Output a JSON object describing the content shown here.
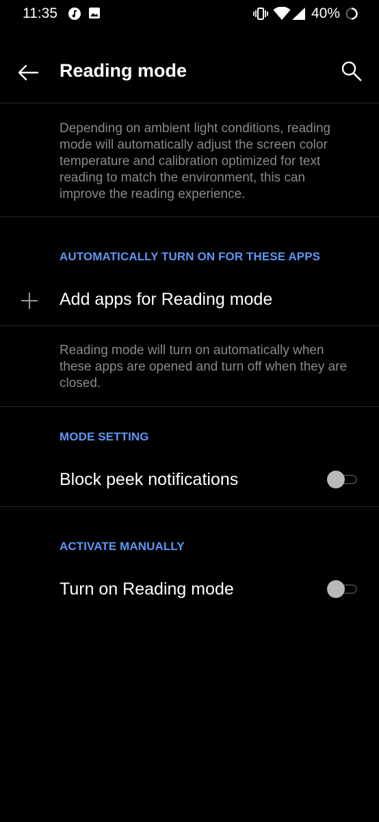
{
  "status_bar": {
    "time": "11:35",
    "battery": "40%",
    "icons": [
      "music-app-icon",
      "image-app-icon",
      "vibrate-icon",
      "wifi-icon",
      "signal-icon",
      "battery-icon"
    ]
  },
  "app_bar": {
    "title": "Reading mode",
    "back_icon": "arrow-left-icon",
    "search_icon": "search-icon"
  },
  "intro": {
    "description_lines": [
      "Depending on ambient light conditions, reading",
      "mode will automatically adjust the screen color",
      "temperature and calibration optimized for text",
      "reading to match the environment, this can",
      "improve the reading experience."
    ]
  },
  "auto_apps": {
    "header": "AUTOMATICALLY TURN ON FOR THESE APPS",
    "add_label": "Add apps for Reading mode",
    "add_icon": "plus-icon",
    "description_lines": [
      "Reading mode will turn on automatically when",
      "these apps are opened and turn off when they are",
      "closed."
    ]
  },
  "mode_setting": {
    "header": "MODE SETTING",
    "block_peek_label": "Block peek notifications",
    "block_peek_enabled": false
  },
  "activate_manually": {
    "header": "ACTIVATE MANUALLY",
    "turn_on_label": "Turn on Reading mode",
    "turn_on_enabled": false
  },
  "colors": {
    "accent": "#5e97f6",
    "background": "#000000",
    "secondary_text": "#8a8a8a",
    "toggle_off_thumb": "#b9b9b9"
  }
}
